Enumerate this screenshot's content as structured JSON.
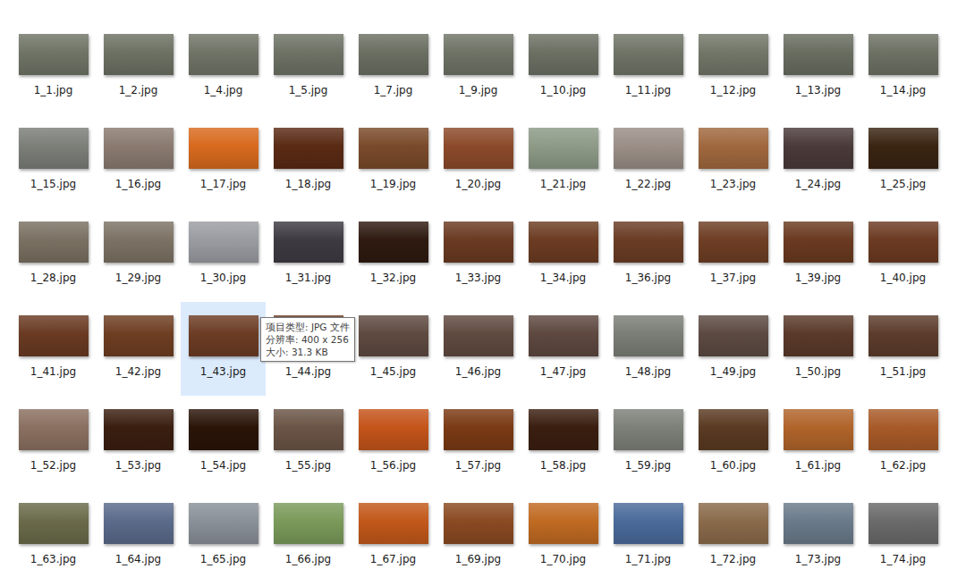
{
  "files": [
    {
      "name": "1_1.jpg",
      "selected": false,
      "color": "#6f7466"
    },
    {
      "name": "1_2.jpg",
      "selected": false,
      "color": "#6c7163"
    },
    {
      "name": "1_4.jpg",
      "selected": false,
      "color": "#707467"
    },
    {
      "name": "1_5.jpg",
      "selected": false,
      "color": "#6d7265"
    },
    {
      "name": "1_7.jpg",
      "selected": false,
      "color": "#6a6f62"
    },
    {
      "name": "1_9.jpg",
      "selected": false,
      "color": "#6e7366"
    },
    {
      "name": "1_10.jpg",
      "selected": false,
      "color": "#6b7063"
    },
    {
      "name": "1_11.jpg",
      "selected": false,
      "color": "#6f7467"
    },
    {
      "name": "1_12.jpg",
      "selected": false,
      "color": "#727668"
    },
    {
      "name": "1_13.jpg",
      "selected": false,
      "color": "#686d60"
    },
    {
      "name": "1_14.jpg",
      "selected": false,
      "color": "#6d7164"
    },
    {
      "name": "1_15.jpg",
      "selected": false,
      "color": "#7b7f78"
    },
    {
      "name": "1_16.jpg",
      "selected": false,
      "color": "#8a7a70"
    },
    {
      "name": "1_17.jpg",
      "selected": false,
      "color": "#d86a1e"
    },
    {
      "name": "1_18.jpg",
      "selected": false,
      "color": "#5a2a14"
    },
    {
      "name": "1_19.jpg",
      "selected": false,
      "color": "#7a4a2a"
    },
    {
      "name": "1_20.jpg",
      "selected": false,
      "color": "#8c4a2a"
    },
    {
      "name": "1_21.jpg",
      "selected": false,
      "color": "#8c9a86"
    },
    {
      "name": "1_22.jpg",
      "selected": false,
      "color": "#9a8e86"
    },
    {
      "name": "1_23.jpg",
      "selected": false,
      "color": "#a0683e"
    },
    {
      "name": "1_24.jpg",
      "selected": false,
      "color": "#4a3a3a"
    },
    {
      "name": "1_25.jpg",
      "selected": false,
      "color": "#3a2412"
    },
    {
      "name": "1_28.jpg",
      "selected": false,
      "color": "#7a7062"
    },
    {
      "name": "1_29.jpg",
      "selected": false,
      "color": "#7c7264"
    },
    {
      "name": "1_30.jpg",
      "selected": false,
      "color": "#9a9ca2"
    },
    {
      "name": "1_31.jpg",
      "selected": false,
      "color": "#3e3a42"
    },
    {
      "name": "1_32.jpg",
      "selected": false,
      "color": "#2e1a10"
    },
    {
      "name": "1_33.jpg",
      "selected": false,
      "color": "#6a3a22"
    },
    {
      "name": "1_34.jpg",
      "selected": false,
      "color": "#6c3c22"
    },
    {
      "name": "1_36.jpg",
      "selected": false,
      "color": "#6a3c24"
    },
    {
      "name": "1_37.jpg",
      "selected": false,
      "color": "#6e3e24"
    },
    {
      "name": "1_39.jpg",
      "selected": false,
      "color": "#6a3a20"
    },
    {
      "name": "1_40.jpg",
      "selected": false,
      "color": "#6c3a22"
    },
    {
      "name": "1_41.jpg",
      "selected": false,
      "color": "#6a3a22"
    },
    {
      "name": "1_42.jpg",
      "selected": false,
      "color": "#6e3e22"
    },
    {
      "name": "1_43.jpg",
      "selected": true,
      "color": "#6c3c24"
    },
    {
      "name": "1_44.jpg",
      "selected": false,
      "color": "#6a3c22"
    },
    {
      "name": "1_45.jpg",
      "selected": false,
      "color": "#5e4a40"
    },
    {
      "name": "1_46.jpg",
      "selected": false,
      "color": "#604a40"
    },
    {
      "name": "1_47.jpg",
      "selected": false,
      "color": "#5e4840"
    },
    {
      "name": "1_48.jpg",
      "selected": false,
      "color": "#7a7e76"
    },
    {
      "name": "1_49.jpg",
      "selected": false,
      "color": "#5c4a42"
    },
    {
      "name": "1_50.jpg",
      "selected": false,
      "color": "#5a3a2a"
    },
    {
      "name": "1_51.jpg",
      "selected": false,
      "color": "#5c3c2c"
    },
    {
      "name": "1_52.jpg",
      "selected": false,
      "color": "#8a7060"
    },
    {
      "name": "1_53.jpg",
      "selected": false,
      "color": "#3a1e10"
    },
    {
      "name": "1_54.jpg",
      "selected": false,
      "color": "#2a1408"
    },
    {
      "name": "1_55.jpg",
      "selected": false,
      "color": "#6a5446"
    },
    {
      "name": "1_56.jpg",
      "selected": false,
      "color": "#c4541a"
    },
    {
      "name": "1_57.jpg",
      "selected": false,
      "color": "#7a3a14"
    },
    {
      "name": "1_58.jpg",
      "selected": false,
      "color": "#3a1e10"
    },
    {
      "name": "1_59.jpg",
      "selected": false,
      "color": "#7c8078"
    },
    {
      "name": "1_60.jpg",
      "selected": false,
      "color": "#5a3a22"
    },
    {
      "name": "1_61.jpg",
      "selected": false,
      "color": "#b0642a"
    },
    {
      "name": "1_62.jpg",
      "selected": false,
      "color": "#a85a28"
    },
    {
      "name": "1_63.jpg",
      "selected": false,
      "color": "#6a6a4a"
    },
    {
      "name": "1_64.jpg",
      "selected": false,
      "color": "#5a6a8a"
    },
    {
      "name": "1_65.jpg",
      "selected": false,
      "color": "#8a9098"
    },
    {
      "name": "1_66.jpg",
      "selected": false,
      "color": "#7a9a5a"
    },
    {
      "name": "1_67.jpg",
      "selected": false,
      "color": "#c2581a"
    },
    {
      "name": "1_69.jpg",
      "selected": false,
      "color": "#8a4a22"
    },
    {
      "name": "1_70.jpg",
      "selected": false,
      "color": "#c06a22"
    },
    {
      "name": "1_71.jpg",
      "selected": false,
      "color": "#4a6a9a"
    },
    {
      "name": "1_72.jpg",
      "selected": false,
      "color": "#8a6a4a"
    },
    {
      "name": "1_73.jpg",
      "selected": false,
      "color": "#6a7a8a"
    },
    {
      "name": "1_74.jpg",
      "selected": false,
      "color": "#6a6a6a"
    }
  ],
  "tooltip": {
    "file": "1_43.jpg",
    "lines": [
      "项目类型: JPG 文件",
      "分辨率: 400 x 256",
      "大小: 31.3 KB"
    ]
  }
}
